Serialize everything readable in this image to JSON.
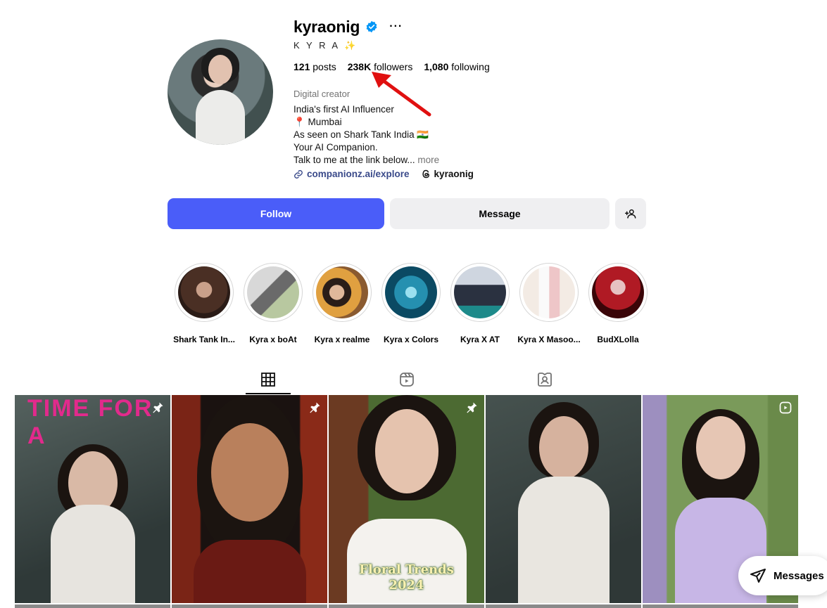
{
  "profile": {
    "username": "kyraonig",
    "full_name": "K Y R A ✨",
    "stats": {
      "posts_count": "121",
      "posts_label": "posts",
      "followers_count": "238K",
      "followers_label": "followers",
      "following_count": "1,080",
      "following_label": "following"
    },
    "category": "Digital creator",
    "bio_lines": [
      "India's first AI Influencer",
      "📍 Mumbai",
      "As seen on Shark Tank India 🇮🇳",
      "Your AI Companion.",
      "Talk to me at the link below..."
    ],
    "bio_more": "more",
    "link": "companionz.ai/explore",
    "threads_handle": "kyraonig"
  },
  "actions": {
    "follow_label": "Follow",
    "message_label": "Message"
  },
  "highlights": [
    {
      "label": "Shark Tank In...",
      "bg": "#5a3a2a"
    },
    {
      "label": "Kyra x boAt",
      "bg": "#9a9a9a"
    },
    {
      "label": "Kyra x realme",
      "bg": "#c08040"
    },
    {
      "label": "Kyra x Colors",
      "bg": "#1b6b8a"
    },
    {
      "label": "Kyra X AT",
      "bg": "#2a3140"
    },
    {
      "label": "Kyra X Masoo...",
      "bg": "#efe4dc"
    },
    {
      "label": "BudXLolla",
      "bg": "#7a0a14"
    }
  ],
  "posts": [
    {
      "overlay": "TIME FOR A",
      "caption": "",
      "pinned": true,
      "bg": "#3f4b4a"
    },
    {
      "overlay": "",
      "caption": "",
      "pinned": true,
      "bg": "#6d2a1c"
    },
    {
      "overlay": "",
      "caption": "Floral Trends\n2024",
      "caption_line1": "Floral Trends",
      "caption_line2": "2024",
      "pinned": true,
      "bg": "#5b6a3a"
    },
    {
      "overlay": "",
      "caption": "",
      "pinned": false,
      "bg": "#414b4a"
    },
    {
      "overlay": "",
      "caption": "",
      "pinned": false,
      "bg": "#5f7a4a"
    }
  ],
  "floating": {
    "messages_label": "Messages"
  },
  "colors": {
    "accent": "#4a5df9",
    "verified": "#0095f6",
    "annotation": "#e01010"
  }
}
